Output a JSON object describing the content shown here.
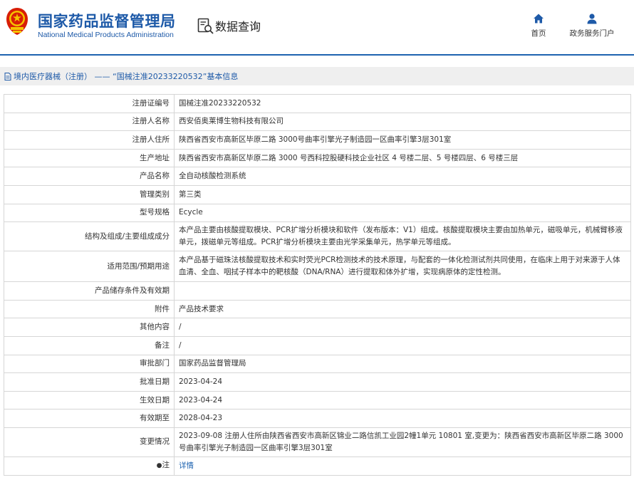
{
  "header": {
    "title_cn": "国家药品监督管理局",
    "title_en": "National Medical Products Administration",
    "query_title": "数据查询",
    "nav": [
      {
        "label": "首页",
        "icon": "home-icon"
      },
      {
        "label": "政务服务门户",
        "icon": "user-icon"
      }
    ],
    "colors": {
      "brand": "#1e5aa8",
      "emblem_red": "#d81e06",
      "emblem_gold": "#f5c400"
    }
  },
  "breadcrumb": "境内医疗器械（注册） —— “国械注准20233220532”基本信息",
  "rows": [
    {
      "label": "注册证编号",
      "value": "国械注准20233220532"
    },
    {
      "label": "注册人名称",
      "value": "西安佰奥莱博生物科技有限公司"
    },
    {
      "label": "注册人住所",
      "value": "陕西省西安市高新区毕原二路 3000号曲率引擎光子制造园一区曲率引擎3层301室"
    },
    {
      "label": "生产地址",
      "value": "陕西省西安市高新区毕原二路 3000 号西科控股硬科技企业社区 4 号楼二层、5 号楼四层、6 号楼三层"
    },
    {
      "label": "产品名称",
      "value": "全自动核酸检测系统"
    },
    {
      "label": "管理类别",
      "value": "第三类"
    },
    {
      "label": "型号规格",
      "value": "Ecycle"
    },
    {
      "label": "结构及组成/主要组成成分",
      "value": "本产品主要由核酸提取模块、PCR扩增分析模块和软件（发布版本：V1）组成。核酸提取模块主要由加热单元，磁吸单元，机械臂移液单元，拨磁单元等组成。PCR扩增分析模块主要由光学采集单元，热学单元等组成。"
    },
    {
      "label": "适用范围/预期用途",
      "value": "本产品基于磁珠法核酸提取技术和实时荧光PCR检测技术的技术原理，与配套的一体化检测试剂共同使用，在临床上用于对来源于人体血清、全血、咽拭子样本中的靶核酸（DNA/RNA）进行提取和体外扩增，实现病原体的定性检测。"
    },
    {
      "label": "产品储存条件及有效期",
      "value": ""
    },
    {
      "label": "附件",
      "value": "产品技术要求"
    },
    {
      "label": "其他内容",
      "value": "/"
    },
    {
      "label": "备注",
      "value": "/"
    },
    {
      "label": "审批部门",
      "value": "国家药品监督管理局"
    },
    {
      "label": "批准日期",
      "value": "2023-04-24"
    },
    {
      "label": "生效日期",
      "value": "2023-04-24"
    },
    {
      "label": "有效期至",
      "value": "2028-04-23"
    },
    {
      "label": "变更情况",
      "value": "2023-09-08 注册人住所由陕西省西安市高新区锦业二路信凯工业园2幢1单元 10801 室,变更为：陕西省西安市高新区毕原二路 3000号曲率引擎光子制造园一区曲率引擎3层301室"
    }
  ],
  "note": {
    "label": "注",
    "link": "详情"
  }
}
